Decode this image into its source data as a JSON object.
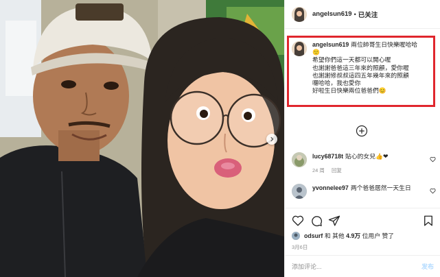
{
  "post": {
    "username": "angelsun619",
    "separator": "•",
    "follow_label": "已关注"
  },
  "caption": {
    "username": "angelsun619",
    "lines": [
      "兩位帥哥生日快樂喔哈哈",
      "🙂",
      "希望你們這一天都可以開心喔",
      "也謝謝爸爸這三年來的照顧，愛你喔",
      "也謝謝修叔叔這四五年幾年來的照顧",
      "囉哈哈，我也愛你",
      "好啦生日快樂兩位爸爸們😊"
    ]
  },
  "comments": [
    {
      "username": "lucy68718t",
      "text": "貼心的女兒👍❤",
      "meta": {
        "time": "24 周",
        "reply": "回复"
      }
    },
    {
      "username": "yvonnelee97",
      "text": "两个爸爸居然一天生日",
      "meta": {
        "time": "",
        "reply": ""
      }
    }
  ],
  "likes": {
    "username": "odsurf",
    "middle": "和 其他",
    "count": "4.9万",
    "suffix": "位用户 赞了"
  },
  "date": "3月6日",
  "comment_box": {
    "placeholder": "添加评论...",
    "post_label": "发布"
  },
  "icons": {
    "next": "chevron-right-icon",
    "load_more": "plus-circle-icon",
    "like": "heart-icon",
    "comment": "comment-icon",
    "share": "paper-plane-icon",
    "save": "bookmark-icon"
  },
  "colors": {
    "highlight": "#e0262d",
    "post_button": "#b3dbff",
    "heart_red": "#ed4956"
  }
}
